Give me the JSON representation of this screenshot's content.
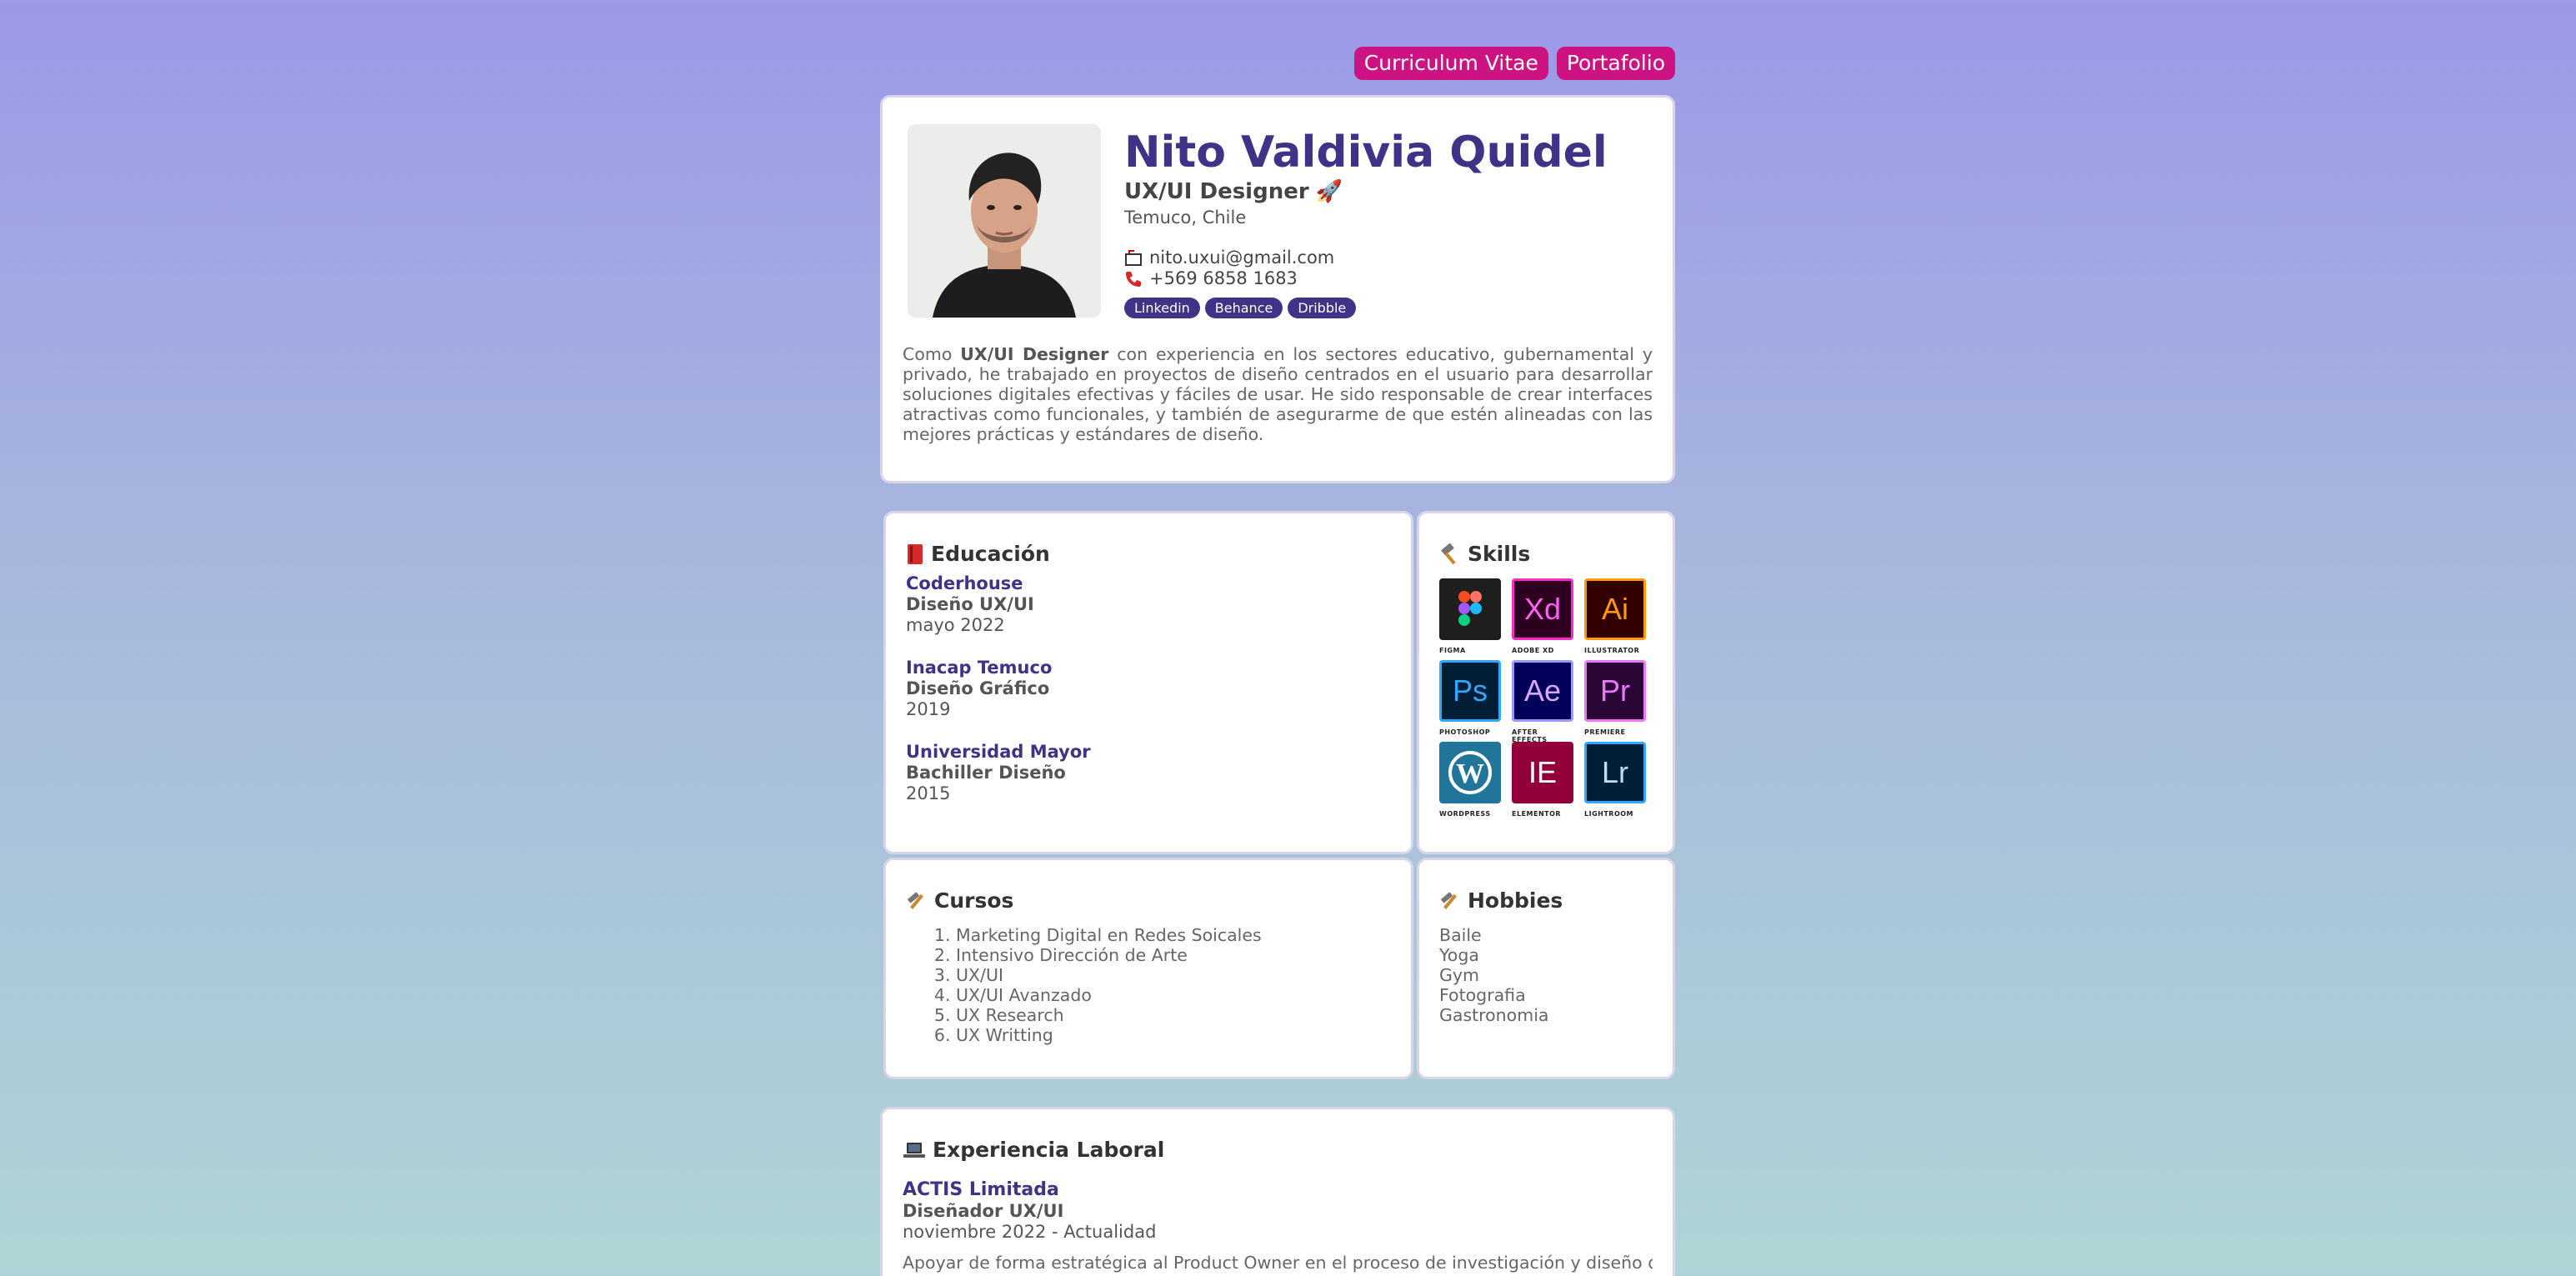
{
  "nav": {
    "cv_label": "Curriculum Vitae",
    "portfolio_label": "Portafolio"
  },
  "profile": {
    "name": "Nito Valdivia Quidel",
    "role": "UX/UI Designer",
    "role_emoji": "🚀",
    "location": "Temuco, Chile",
    "email": "nito.uxui@gmail.com",
    "phone": "+569 6858 1683",
    "links": [
      "Linkedin",
      "Behance",
      "Dribble"
    ],
    "about_prefix": "Como",
    "about_bold": "UX/UI Designer",
    "about_rest": "con experiencia en los sectores educativo, gubernamental y privado, he trabajado en proyectos de diseño centrados en el usuario para desarrollar soluciones digitales efectivas y fáciles de usar. He sido responsable de crear interfaces atractivas como funcionales, y también de asegurarme de que estén alineadas con las mejores prácticas y estándares de diseño."
  },
  "education": {
    "title": "Educación",
    "items": [
      {
        "institution": "Coderhouse",
        "degree": "Diseño UX/UI",
        "year": "mayo 2022"
      },
      {
        "institution": "Inacap Temuco",
        "degree": "Diseño Gráfico",
        "year": "2019"
      },
      {
        "institution": "Universidad Mayor",
        "degree": "Bachiller Diseño",
        "year": "2015"
      }
    ]
  },
  "skills": {
    "title": "Skills",
    "items": [
      {
        "abbr": "",
        "label": "FIGMA",
        "bg": "#1e1e1e",
        "border": "#1e1e1e",
        "fg": "#ffffff"
      },
      {
        "abbr": "Xd",
        "label": "ADOBE XD",
        "bg": "#2e001f",
        "border": "#ff2bc2",
        "fg": "#ff61f6"
      },
      {
        "abbr": "Ai",
        "label": "ILLUSTRATOR",
        "bg": "#330000",
        "border": "#ff9a00",
        "fg": "#ff9a00"
      },
      {
        "abbr": "Ps",
        "label": "PHOTOSHOP",
        "bg": "#001e36",
        "border": "#31a8ff",
        "fg": "#31a8ff"
      },
      {
        "abbr": "Ae",
        "label": "AFTER EFFECTS",
        "bg": "#00005b",
        "border": "#9999ff",
        "fg": "#d9a7ff"
      },
      {
        "abbr": "Pr",
        "label": "PREMIERE",
        "bg": "#2a0634",
        "border": "#ea77ff",
        "fg": "#ea77ff"
      },
      {
        "abbr": "W",
        "label": "WORDPRESS",
        "bg": "#21759b",
        "border": "#21759b",
        "fg": "#ffffff"
      },
      {
        "abbr": "IE",
        "label": "ELEMENTOR",
        "bg": "#92003b",
        "border": "#92003b",
        "fg": "#ffffff"
      },
      {
        "abbr": "Lr",
        "label": "LIGHTROOM",
        "bg": "#001e36",
        "border": "#31a8ff",
        "fg": "#b6e0ff"
      }
    ]
  },
  "courses": {
    "title": "Cursos",
    "items": [
      "Marketing Digital en Redes Soicales",
      "Intensivo Dirección de Arte",
      "UX/UI",
      "UX/UI Avanzado",
      "UX Research",
      "UX Writting"
    ]
  },
  "hobbies": {
    "title": "Hobbies",
    "items": [
      "Baile",
      "Yoga",
      "Gym",
      "Fotografia",
      "Gastronomia"
    ]
  },
  "experience": {
    "title": "Experiencia Laboral",
    "items": [
      {
        "company": "ACTIS Limitada",
        "role": "Diseñador UX/UI",
        "dates": "noviembre 2022 - Actualidad",
        "desc": "Apoyar de forma estratégica al Product Owner en el proceso de investigación y diseño de la"
      }
    ]
  },
  "colors": {
    "accent": "#3f3388",
    "nav": "#cc1381"
  }
}
